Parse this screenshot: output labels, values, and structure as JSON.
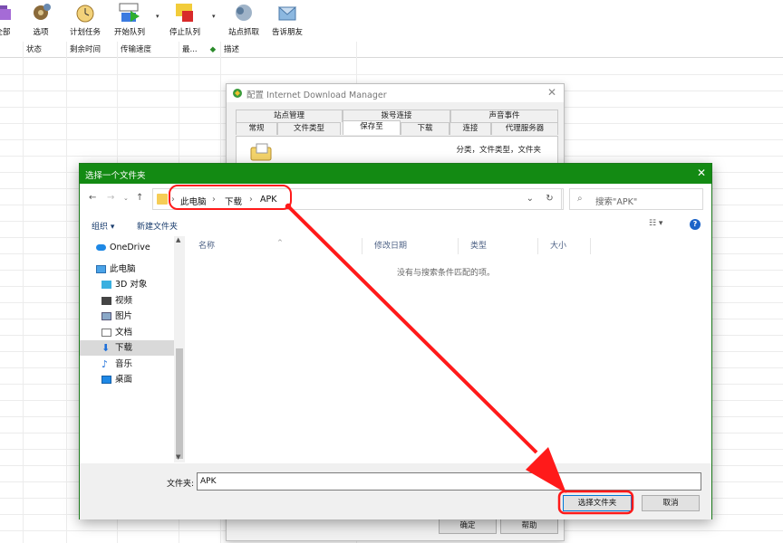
{
  "toolbar": {
    "items": [
      {
        "label": "全部",
        "icon": "delete-all-icon"
      },
      {
        "label": "选项",
        "icon": "gear-icon"
      },
      {
        "label": "计划任务",
        "icon": "scheduler-clock-icon"
      },
      {
        "label": "开始队列",
        "icon": "start-queue-icon"
      },
      {
        "label": "停止队列",
        "icon": "stop-queue-icon"
      },
      {
        "label": "站点抓取",
        "icon": "site-grabber-icon"
      },
      {
        "label": "告诉朋友",
        "icon": "tell-friend-icon"
      }
    ]
  },
  "columns": [
    "状态",
    "剩余时间",
    "传输速度",
    "最...",
    "描述"
  ],
  "config_dialog": {
    "title": "配置 Internet Download Manager",
    "tabs_top": [
      "站点管理",
      "拨号连接",
      "声音事件"
    ],
    "tabs_bottom": [
      "常规",
      "文件类型",
      "保存至",
      "下载",
      "连接",
      "代理服务器"
    ],
    "description": "分类，文件类型，文件夹",
    "ok_label": "确定",
    "help_label": "帮助"
  },
  "folder_dialog": {
    "title": "选择一个文件夹",
    "breadcrumb": [
      "此电脑",
      "下载",
      "APK"
    ],
    "search_placeholder": "搜索\"APK\"",
    "organize_label": "组织 ▾",
    "new_folder_label": "新建文件夹",
    "view_label": "☷ ▾",
    "help_label": "?",
    "nav_items": [
      {
        "label": "OneDrive",
        "icon": "cloud-icon"
      },
      {
        "label": "此电脑",
        "icon": "computer-icon"
      },
      {
        "label": "3D 对象",
        "icon": "3d-objects-icon"
      },
      {
        "label": "视频",
        "icon": "video-icon"
      },
      {
        "label": "图片",
        "icon": "pictures-icon"
      },
      {
        "label": "文档",
        "icon": "documents-icon"
      },
      {
        "label": "下载",
        "icon": "download-arrow-icon"
      },
      {
        "label": "音乐",
        "icon": "music-note-icon"
      },
      {
        "label": "桌面",
        "icon": "desktop-icon"
      }
    ],
    "list_columns": [
      "名称",
      "修改日期",
      "类型",
      "大小"
    ],
    "empty_message": "没有与搜索条件匹配的项。",
    "folder_label": "文件夹:",
    "folder_value": "APK",
    "select_button": "选择文件夹",
    "cancel_button": "取消"
  },
  "colors": {
    "dialog_title_bg": "#138a13",
    "annotation": "#ff1a1a"
  }
}
